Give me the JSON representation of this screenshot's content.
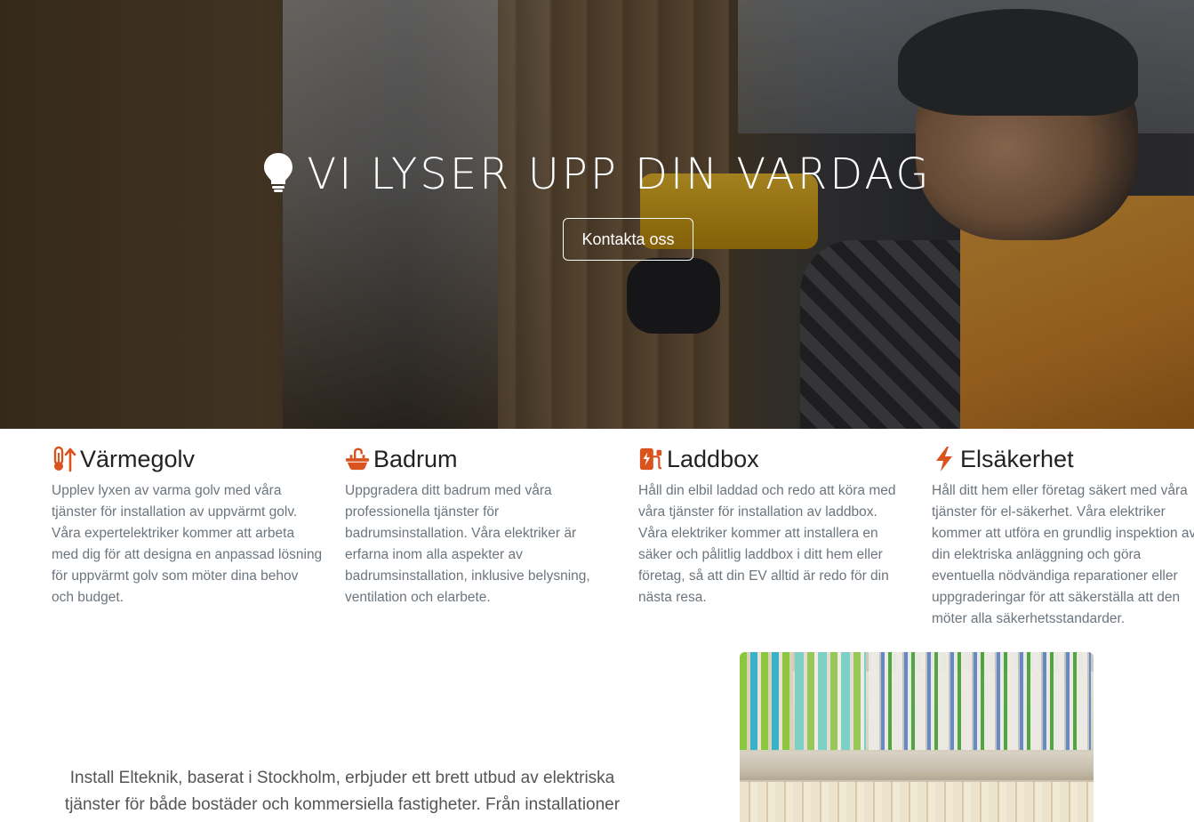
{
  "hero": {
    "title": "VI LYSER UPP DIN VARDAG",
    "cta_label": "Kontakta oss",
    "icon": "lightbulb-icon"
  },
  "services": [
    {
      "title": "Värmegolv",
      "icon": "thermometer-arrow-up-icon",
      "text": "Upplev lyxen av varma golv med våra tjänster för installation av uppvärmt golv. Våra expertelektriker kommer att arbeta med dig för att designa en anpassad lösning för uppvärmt golv som möter dina behov och budget."
    },
    {
      "title": "Badrum",
      "icon": "sink-faucet-icon",
      "text": "Uppgradera ditt badrum med våra professionella tjänster för badrumsinstallation. Våra elektriker är erfarna inom alla aspekter av badrumsinstallation, inklusive belysning, ventilation och elarbete."
    },
    {
      "title": "Laddbox",
      "icon": "ev-charger-icon",
      "text": "Håll din elbil laddad och redo att köra med våra tjänster för installation av laddbox. Våra elektriker kommer att installera en säker och pålitlig laddbox i ditt hem eller företag, så att din EV alltid är redo för din nästa resa."
    },
    {
      "title": "Elsäkerhet",
      "icon": "lightning-bolt-icon",
      "text": "Håll ditt hem eller företag säkert med våra tjänster för el-säkerhet. Våra elektriker kommer att utföra en grundlig inspektion av din elektriska anläggning och göra eventuella nödvändiga reparationer eller uppgraderingar för att säkerställa att den möter alla säkerhetsstandarder."
    }
  ],
  "about": {
    "text": "Install Elteknik, baserat i Stockholm, erbjuder ett brett utbud av elektriska tjänster för både bostäder och kommersiella fastigheter. Från installationer"
  },
  "colors": {
    "accent": "#d9531e",
    "text_muted": "#6c757d",
    "heading": "#222222"
  }
}
